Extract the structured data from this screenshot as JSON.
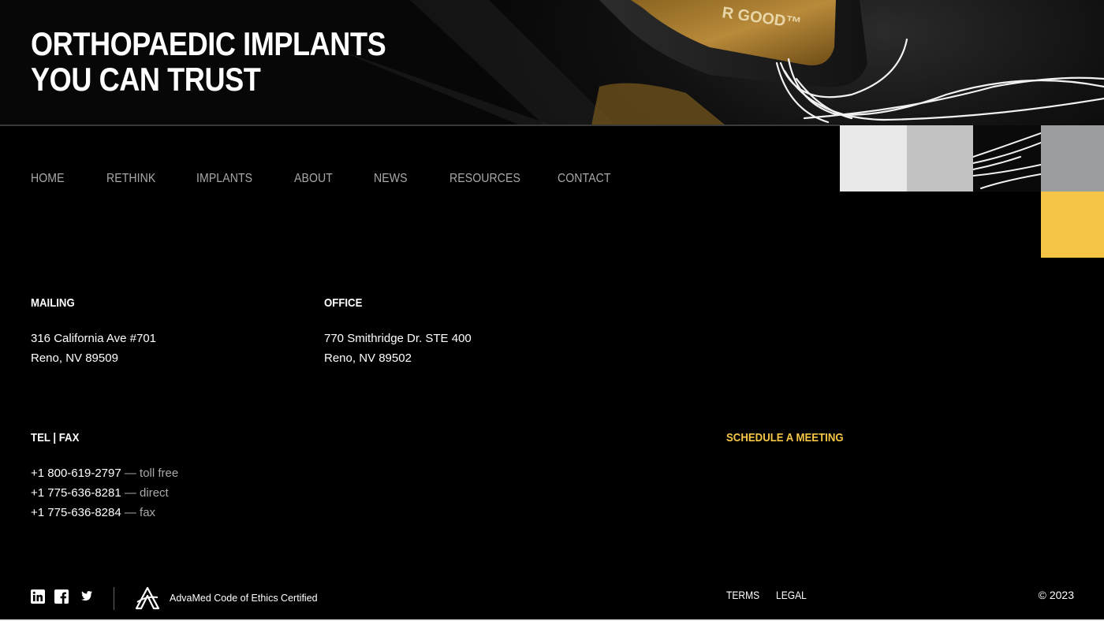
{
  "hero": {
    "title_line1": "ORTHOPAEDIC IMPLANTS",
    "title_line2": "YOU CAN TRUST",
    "image_text": "R GOOD™"
  },
  "nav": {
    "items": [
      {
        "label": "HOME"
      },
      {
        "label": "RETHINK"
      },
      {
        "label": "IMPLANTS"
      },
      {
        "label": "ABOUT"
      },
      {
        "label": "NEWS"
      },
      {
        "label": "RESOURCES"
      },
      {
        "label": "CONTACT"
      }
    ]
  },
  "blocks": {
    "colors": [
      "#e9e9e9",
      "#c2c2c2",
      "#9c9d9f",
      "#f5c645"
    ]
  },
  "mailing": {
    "heading": "MAILING",
    "line1": "316 California Ave #701",
    "line2": "Reno, NV 89509"
  },
  "office": {
    "heading": "OFFICE",
    "line1": "770 Smithridge Dr. STE 400",
    "line2": "Reno, NV 89502"
  },
  "contact": {
    "heading": "TEL | FAX",
    "phones": [
      {
        "number": "+1 800-619-2797",
        "sep": " — ",
        "kind": "toll free"
      },
      {
        "number": "+1 775-636-8281",
        "sep": " — ",
        "kind": "direct"
      },
      {
        "number": "+1 775-636-8284",
        "sep": " — ",
        "kind": "fax"
      }
    ]
  },
  "cta": {
    "schedule_label": "SCHEDULE A MEETING",
    "accent_color": "#f5c645"
  },
  "footer": {
    "social_icons": [
      "linkedin-icon",
      "facebook-icon",
      "twitter-icon"
    ],
    "advamed_text": "AdvaMed Code of Ethics Certified",
    "terms": "TERMS",
    "legal": "LEGAL",
    "copyright": "© 2023"
  }
}
